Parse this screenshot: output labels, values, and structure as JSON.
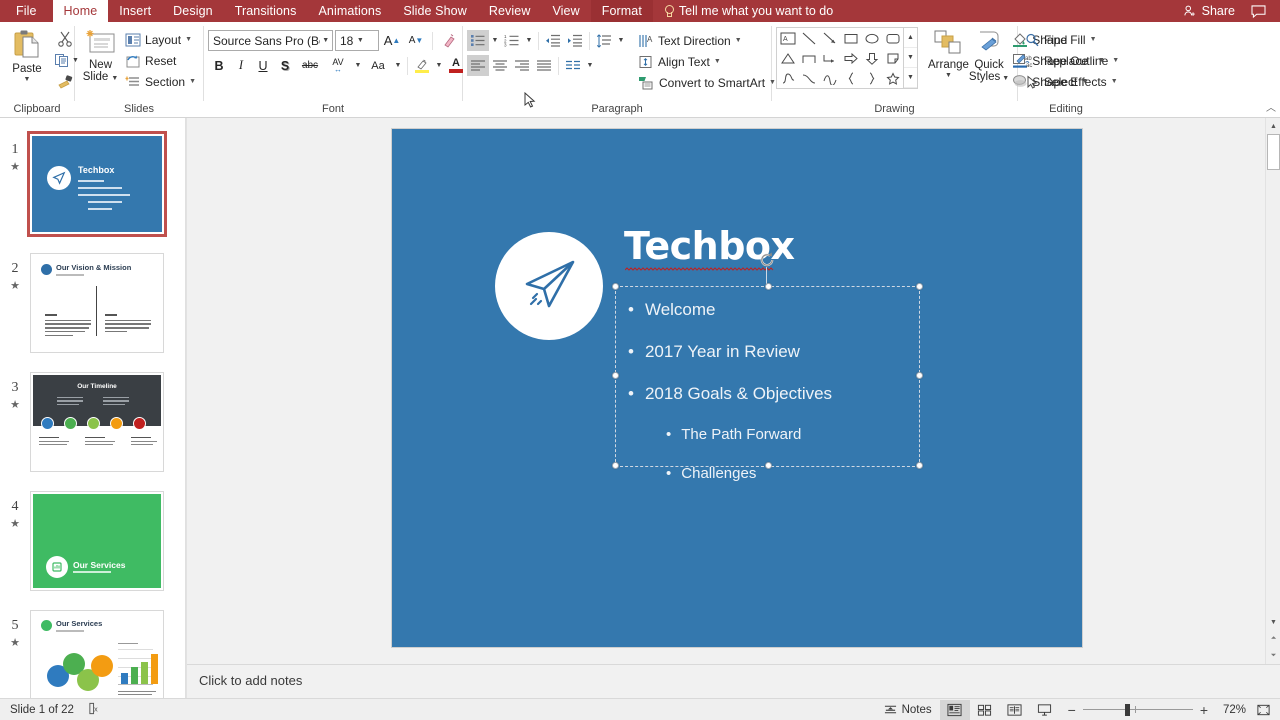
{
  "window": {
    "tabs": [
      {
        "id": "file",
        "label": "File",
        "state": "file"
      },
      {
        "id": "home",
        "label": "Home",
        "state": "active"
      },
      {
        "id": "insert",
        "label": "Insert",
        "state": "normal"
      },
      {
        "id": "design",
        "label": "Design",
        "state": "normal"
      },
      {
        "id": "transitions",
        "label": "Transitions",
        "state": "normal"
      },
      {
        "id": "animations",
        "label": "Animations",
        "state": "normal"
      },
      {
        "id": "slideshow",
        "label": "Slide Show",
        "state": "normal"
      },
      {
        "id": "review",
        "label": "Review",
        "state": "normal"
      },
      {
        "id": "view",
        "label": "View",
        "state": "normal"
      },
      {
        "id": "format",
        "label": "Format",
        "state": "contextual"
      }
    ],
    "tell_me": "Tell me what you want to do",
    "share": "Share",
    "accent": "#a4373a"
  },
  "ribbon": {
    "clipboard": {
      "paste": "Paste",
      "cut": "cut-icon",
      "copy": "copy-icon",
      "format_painter": "format-painter-icon",
      "group_label": "Clipboard"
    },
    "slides": {
      "new_slide": "New\nSlide",
      "new_slide_line1": "New",
      "new_slide_line2": "Slide",
      "layout": "Layout",
      "reset": "Reset",
      "section": "Section",
      "group_label": "Slides"
    },
    "font": {
      "font_name": "Source Sans Pro (Bod",
      "font_size": "18",
      "increase_size": "A",
      "decrease_size": "A",
      "clear_formatting": "clear-formatting-icon",
      "bold": "B",
      "italic": "I",
      "underline": "U",
      "shadow": "S",
      "strikethrough": "abc",
      "character_spacing": "AV",
      "change_case": "Aa",
      "highlight": "text-highlight-icon",
      "font_color": "A",
      "group_label": "Font"
    },
    "paragraph": {
      "bullets": "bullets-icon",
      "numbering": "numbering-icon",
      "decrease_indent": "decrease-indent-icon",
      "increase_indent": "increase-indent-icon",
      "line_spacing": "line-spacing-icon",
      "text_direction": "Text Direction",
      "align_text": "Align Text",
      "convert_smartart": "Convert to SmartArt",
      "align_left": "align-left-icon",
      "align_center": "align-center-icon",
      "align_right": "align-right-icon",
      "justify": "justify-icon",
      "columns": "columns-icon",
      "group_label": "Paragraph"
    },
    "drawing": {
      "arrange": "Arrange",
      "quick_styles_line1": "Quick",
      "quick_styles_line2": "Styles",
      "shape_fill": "Shape Fill",
      "shape_outline": "Shape Outline",
      "shape_effects": "Shape Effects",
      "group_label": "Drawing"
    },
    "editing": {
      "find": "Find",
      "replace": "Replace",
      "select": "Select",
      "group_label": "Editing"
    }
  },
  "thumbnails": [
    {
      "number": "1",
      "title": "Techbox",
      "selected": true,
      "kind": "title-blue"
    },
    {
      "number": "2",
      "title": "Our Vision & Mission",
      "selected": false,
      "kind": "vision-white"
    },
    {
      "number": "3",
      "title": "Our Timeline",
      "selected": false,
      "kind": "timeline-dark"
    },
    {
      "number": "4",
      "title": "Our Services",
      "selected": false,
      "kind": "services-green"
    },
    {
      "number": "5",
      "title": "Our Services",
      "selected": false,
      "kind": "services-chart"
    }
  ],
  "slide": {
    "background_color": "#3478ae",
    "title": "Techbox",
    "logo": "paper-plane-icon",
    "bullets": [
      {
        "text": "Welcome",
        "level": 1
      },
      {
        "text": "2017 Year in Review",
        "level": 1
      },
      {
        "text": "2018 Goals & Objectives",
        "level": 1
      },
      {
        "text": "The Path Forward",
        "level": 2
      },
      {
        "text": "Challenges",
        "level": 2
      }
    ],
    "selected": true,
    "spellcheck_underline": true
  },
  "notes": {
    "placeholder": "Click to add notes"
  },
  "status": {
    "slide_counter": "Slide 1 of 22",
    "language_icon": "accessibility-icon",
    "notes_label": "Notes",
    "views": [
      {
        "id": "normal",
        "name": "normal-view-icon",
        "selected": true
      },
      {
        "id": "slide-sorter",
        "name": "slide-sorter-view-icon",
        "selected": false
      },
      {
        "id": "reading",
        "name": "reading-view-icon",
        "selected": false
      },
      {
        "id": "slideshow",
        "name": "slide-show-icon",
        "selected": false
      }
    ],
    "zoom_out": "−",
    "zoom_in": "+",
    "zoom_level": "72%",
    "fit_to_window": "fit-slide-icon"
  }
}
